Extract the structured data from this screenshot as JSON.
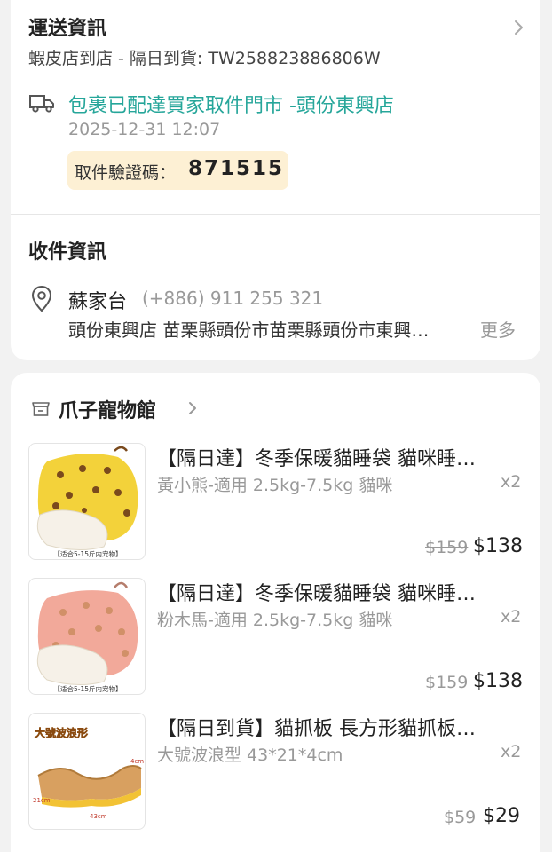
{
  "shipping": {
    "title": "運送資訊",
    "subtitle": "蝦皮店到店 - 隔日到貨: TW258823886806W",
    "status": "包裹已配達買家取件門市  -頭份東興店",
    "status_time": "2025-12-31 12:07",
    "code_label": "取件驗證碼：",
    "code_value": "871515",
    "status_color": "#26a69a"
  },
  "receiver": {
    "title": "收件資訊",
    "name": "蘇家台",
    "phone": "(+886) 911 255 321",
    "address": "頭份東興店 苗栗縣頭份市苗栗縣頭份市東興…",
    "more": "更多"
  },
  "shop": {
    "name": "爪子寵物館",
    "items": [
      {
        "title": "【隔日達】冬季保暖貓睡袋 貓咪睡…",
        "variant": "黃小熊-適用 2.5kg-7.5kg 貓咪",
        "qty": "x2",
        "orig_price": "$159",
        "price": "$138",
        "thumb_caption": "【适合5-15斤内宠物】",
        "thumb_color": "#f3d23a"
      },
      {
        "title": "【隔日達】冬季保暖貓睡袋 貓咪睡…",
        "variant": "粉木馬-適用 2.5kg-7.5kg 貓咪",
        "qty": "x2",
        "orig_price": "$159",
        "price": "$138",
        "thumb_caption": "【适合5-15斤内宠物】",
        "thumb_color": "#f2a99a"
      },
      {
        "title": "【隔日到貨】貓抓板 長方形貓抓板…",
        "variant": "大號波浪型 43*21*4cm",
        "qty": "x2",
        "orig_price": "$59",
        "price": "$29",
        "thumb_caption": "大號波浪形",
        "thumb_dims": [
          "4cm",
          "21cm",
          "43cm"
        ]
      }
    ]
  }
}
